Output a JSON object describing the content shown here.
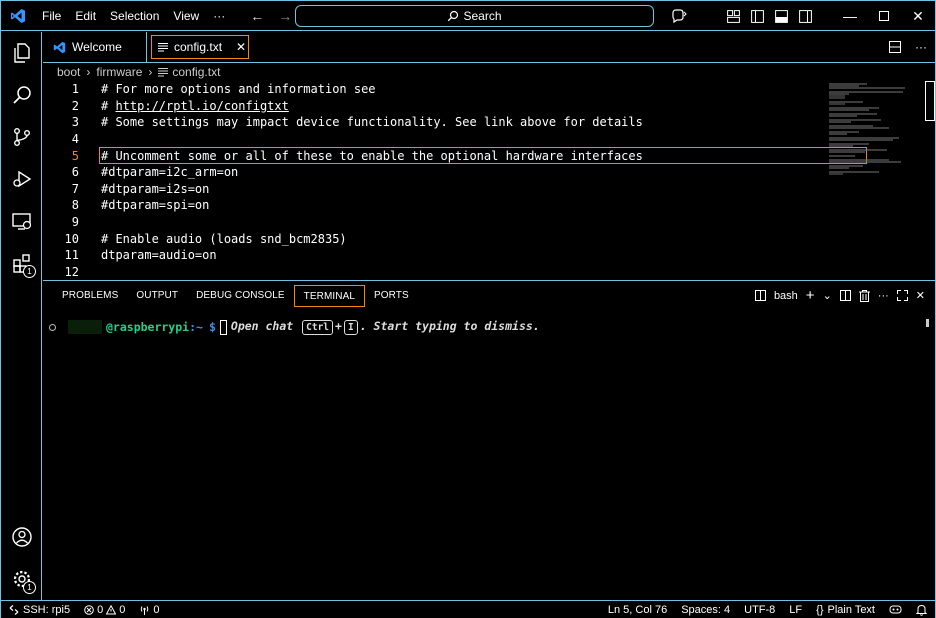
{
  "titlebar": {
    "menu": [
      "File",
      "Edit",
      "Selection",
      "View"
    ],
    "more": "···",
    "search_placeholder": "Search"
  },
  "tabs": [
    {
      "label": "Welcome",
      "active": false
    },
    {
      "label": "config.txt",
      "active": true,
      "close": "✕"
    }
  ],
  "breadcrumb": [
    "boot",
    "firmware",
    "config.txt"
  ],
  "editor": {
    "current_line": 5,
    "lines": [
      {
        "n": "1",
        "text": "# For more options and information see"
      },
      {
        "n": "2",
        "text": "# ",
        "link": "http://rptl.io/configtxt"
      },
      {
        "n": "3",
        "text": "# Some settings may impact device functionality. See link above for details"
      },
      {
        "n": "4",
        "text": ""
      },
      {
        "n": "5",
        "text": "# Uncomment some or all of these to enable the optional hardware interfaces"
      },
      {
        "n": "6",
        "text": "#dtparam=i2c_arm=on"
      },
      {
        "n": "7",
        "text": "#dtparam=i2s=on"
      },
      {
        "n": "8",
        "text": "#dtparam=spi=on"
      },
      {
        "n": "9",
        "text": ""
      },
      {
        "n": "10",
        "text": "# Enable audio (loads snd_bcm2835)"
      },
      {
        "n": "11",
        "text": "dtparam=audio=on"
      },
      {
        "n": "12",
        "text": ""
      }
    ]
  },
  "panel": {
    "tabs": [
      "PROBLEMS",
      "OUTPUT",
      "DEBUG CONSOLE",
      "TERMINAL",
      "PORTS"
    ],
    "active_tab": "TERMINAL",
    "shell": "bash",
    "terminal": {
      "host": "@raspberrypi",
      "path": ":~",
      "prompt": "$",
      "hint_before": "Open chat",
      "key1": "Ctrl",
      "plus": "+",
      "key2": "I",
      "hint_after": ". Start typing to dismiss."
    }
  },
  "activitybar": {
    "extensions_badge": "1",
    "settings_badge": "1"
  },
  "statusbar": {
    "remote": "SSH: rpi5",
    "errors": "0",
    "warnings": "0",
    "ports": "0",
    "position": "Ln 5, Col 76",
    "spaces": "Spaces: 4",
    "encoding": "UTF-8",
    "eol": "LF",
    "language": "Plain Text"
  },
  "colors": {
    "contrast_border": "#6fc3df",
    "active_border": "#f38518",
    "accent_blue": "#3794ff",
    "terminal_green": "#23d18b",
    "terminal_blue": "#3b8eea"
  }
}
